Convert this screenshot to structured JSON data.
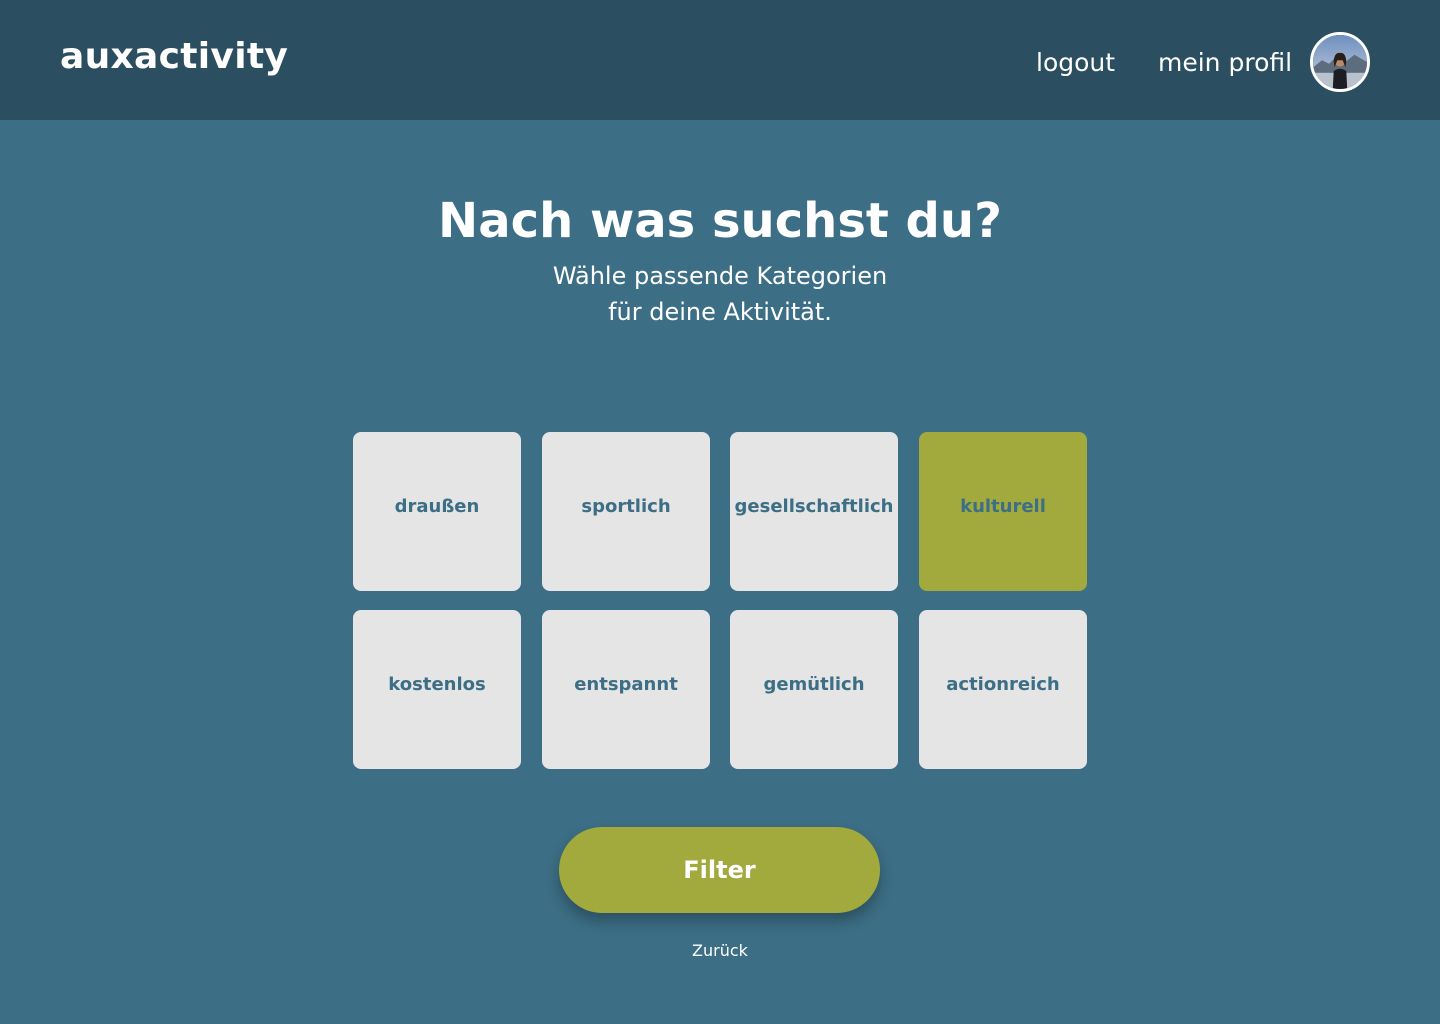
{
  "header": {
    "logo": "auxactivity",
    "nav": {
      "logout": "logout",
      "profile": "mein profil"
    }
  },
  "main": {
    "title": "Nach was suchst du?",
    "subtitle_line1": "Wähle passende Kategorien",
    "subtitle_line2": "für deine Aktivität.",
    "categories": [
      {
        "label": "draußen",
        "selected": false
      },
      {
        "label": "sportlich",
        "selected": false
      },
      {
        "label": "gesellschaftlich",
        "selected": false
      },
      {
        "label": "kulturell",
        "selected": true
      },
      {
        "label": "kostenlos",
        "selected": false
      },
      {
        "label": "entspannt",
        "selected": false
      },
      {
        "label": "gemütlich",
        "selected": false
      },
      {
        "label": "actionreich",
        "selected": false
      }
    ],
    "filter_button": "Filter",
    "back_link": "Zurück"
  },
  "colors": {
    "background": "#3c6e85",
    "header": "#2b4e60",
    "tile": "#e5e5e5",
    "tile_text": "#3c6e85",
    "accent": "#a2aa3e",
    "text": "#ffffff"
  }
}
